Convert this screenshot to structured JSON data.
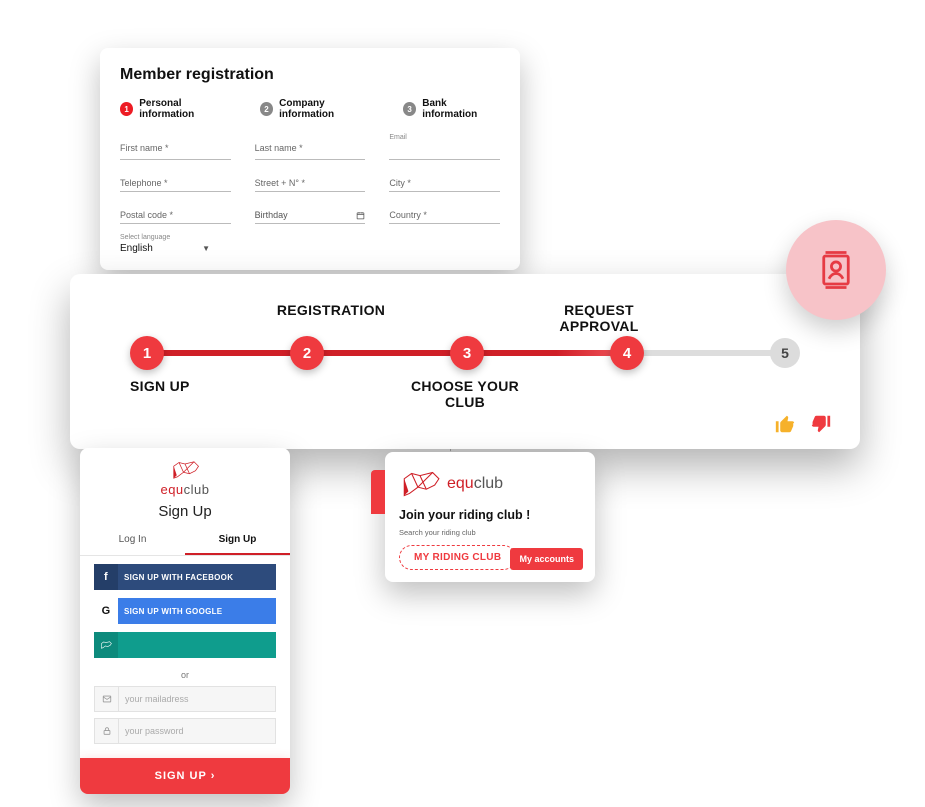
{
  "registration": {
    "title": "Member registration",
    "steps": [
      {
        "num": "1",
        "label": "Personal information",
        "active": true
      },
      {
        "num": "2",
        "label": "Company information",
        "active": false
      },
      {
        "num": "3",
        "label": "Bank information",
        "active": false
      }
    ],
    "fields": {
      "first_name": "First name *",
      "last_name": "Last name *",
      "email_label": "Email",
      "telephone": "Telephone *",
      "street": "Street + N° *",
      "city": "City *",
      "postal": "Postal code *",
      "birthday": "Birthday",
      "country": "Country *"
    },
    "lang_label": "Select language",
    "lang_value": "English"
  },
  "flow": {
    "nodes": [
      "1",
      "2",
      "3",
      "4",
      "5"
    ],
    "top_labels": {
      "n2": "REGISTRATION",
      "n4": "REQUEST APPROVAL"
    },
    "bottom_labels": {
      "n1": "SIGN UP",
      "n3": "CHOOSE YOUR CLUB"
    }
  },
  "signup": {
    "brand_left": "equ",
    "brand_right": "club",
    "title": "Sign Up",
    "tab_login": "Log In",
    "tab_signup": "Sign Up",
    "btn_fb": "SIGN UP WITH FACEBOOK",
    "btn_gg": "SIGN UP WITH GOOGLE",
    "or": "or",
    "email_ph": "your mailadress",
    "pass_ph": "your password",
    "submit": "SIGN UP "
  },
  "club": {
    "brand_left": "equ",
    "brand_right": "club",
    "title": "Join your riding club !",
    "subtitle": "Search your riding club",
    "chip": "MY RIDING CLUB",
    "accounts": "My accounts"
  }
}
